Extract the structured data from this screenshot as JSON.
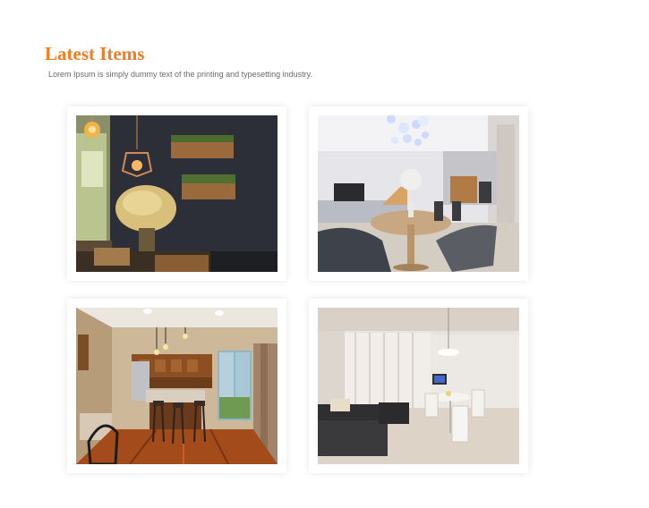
{
  "section": {
    "title": "Latest Items",
    "description": "Lorem Ipsum is simply dummy text of the printing and typesetting industry."
  },
  "items": [
    {
      "image": "interior-dark-wall-pendant-lamps-photo"
    },
    {
      "image": "dining-room-round-table-chandelier-photo"
    },
    {
      "image": "wooden-kitchen-bar-stools-photo"
    },
    {
      "image": "bright-living-room-black-sofa-photo"
    }
  ],
  "colors": {
    "accent": "#f47b20",
    "text_muted": "#6b6b6b"
  }
}
